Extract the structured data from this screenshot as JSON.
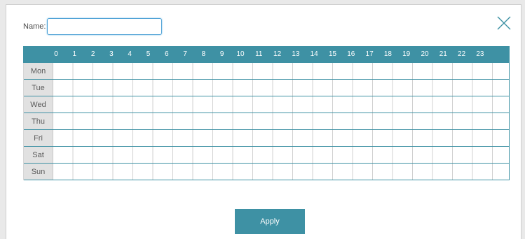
{
  "form": {
    "name_label": "Name:",
    "name_value": ""
  },
  "schedule": {
    "hours": [
      "0",
      "1",
      "2",
      "3",
      "4",
      "5",
      "6",
      "7",
      "8",
      "9",
      "10",
      "11",
      "12",
      "13",
      "14",
      "15",
      "16",
      "17",
      "18",
      "19",
      "20",
      "21",
      "22",
      "23"
    ],
    "days": [
      "Mon",
      "Tue",
      "Wed",
      "Thu",
      "Fri",
      "Sat",
      "Sun"
    ]
  },
  "actions": {
    "apply_label": "Apply"
  },
  "colors": {
    "accent": "#3e91a4",
    "input_focus": "#4fa2d6"
  },
  "icons": {
    "close": "close-icon"
  }
}
